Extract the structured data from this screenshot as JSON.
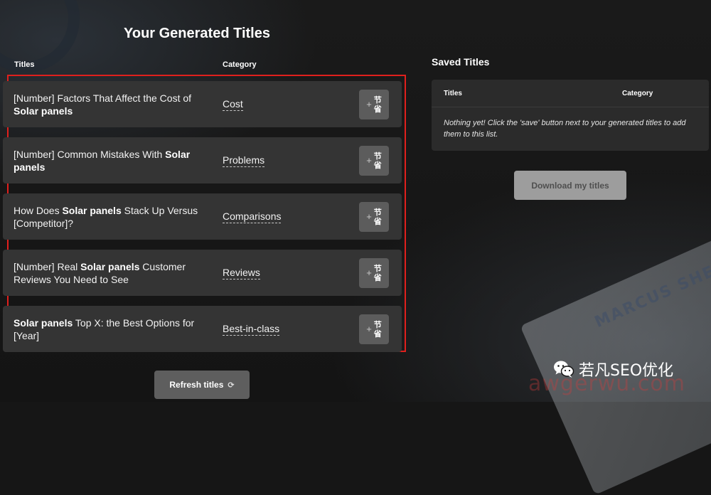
{
  "heading": "Your Generated Titles",
  "columns": {
    "titles": "Titles",
    "category": "Category"
  },
  "rows": [
    {
      "title_parts": [
        {
          "text": "[Number] Factors That Affect the Cost of ",
          "bold": false
        },
        {
          "text": "Solar panels",
          "bold": true
        }
      ],
      "category": "Cost",
      "save_glyph_1": "节",
      "save_glyph_2": "省"
    },
    {
      "title_parts": [
        {
          "text": "[Number] Common Mistakes With ",
          "bold": false
        },
        {
          "text": "Solar panels",
          "bold": true
        }
      ],
      "category": "Problems",
      "save_glyph_1": "节",
      "save_glyph_2": "省"
    },
    {
      "title_parts": [
        {
          "text": "How Does ",
          "bold": false
        },
        {
          "text": "Solar panels",
          "bold": true
        },
        {
          "text": " Stack Up Versus [Competitor]?",
          "bold": false
        }
      ],
      "category": "Comparisons",
      "save_glyph_1": "节",
      "save_glyph_2": "省"
    },
    {
      "title_parts": [
        {
          "text": "[Number] Real ",
          "bold": false
        },
        {
          "text": "Solar panels",
          "bold": true
        },
        {
          "text": " Customer Reviews You Need to See",
          "bold": false
        }
      ],
      "category": "Reviews",
      "save_glyph_1": "节",
      "save_glyph_2": "省"
    },
    {
      "title_parts": [
        {
          "text": "Solar panels",
          "bold": true
        },
        {
          "text": " Top X: the Best Options for [Year]",
          "bold": false
        }
      ],
      "category": "Best-in-class",
      "save_glyph_1": "节",
      "save_glyph_2": "省"
    }
  ],
  "save_plus": "+",
  "refresh": {
    "label": "Refresh titles",
    "icon_glyph": "⟳",
    "icon": "refresh-icon"
  },
  "saved": {
    "heading": "Saved Titles",
    "col_titles": "Titles",
    "col_category": "Category",
    "empty_message": "Nothing yet! Click the 'save' button next to your generated titles to add them to this list."
  },
  "download_label": "Download my titles",
  "background_card_text": "MARCUS SHE",
  "watermark": {
    "text": "若凡SEO优化",
    "url": "awgerwu.com"
  },
  "colors": {
    "highlight_border": "#e0201d",
    "row_bg": "#343434",
    "button_bg": "#5c5c5c",
    "download_bg": "#9d9d9d"
  }
}
